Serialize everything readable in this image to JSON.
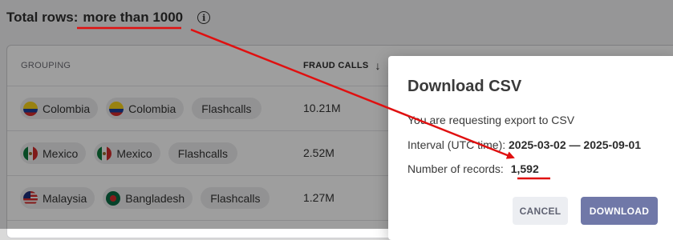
{
  "header": {
    "total_rows_label": "Total rows:",
    "total_rows_value": "more than 1000"
  },
  "table": {
    "columns": {
      "grouping": "GROUPING",
      "fraud_calls": "FRAUD CALLS"
    },
    "rows": [
      {
        "from": "Colombia",
        "to": "Colombia",
        "type": "Flashcalls",
        "fraud_calls": "10.21M"
      },
      {
        "from": "Mexico",
        "to": "Mexico",
        "type": "Flashcalls",
        "fraud_calls": "2.52M"
      },
      {
        "from": "Malaysia",
        "to": "Bangladesh",
        "type": "Flashcalls",
        "fraud_calls": "1.27M"
      }
    ]
  },
  "dialog": {
    "title": "Download CSV",
    "request_text": "You are requesting export to CSV",
    "interval_label": "Interval (UTC time):",
    "interval_value": "2025-03-02 — 2025-09-01",
    "records_label": "Number of records:",
    "records_value": "1,592",
    "cancel_label": "CANCEL",
    "download_label": "DOWNLOAD"
  },
  "icons": {
    "info": "info-icon",
    "sort": "arrow-down-icon"
  },
  "colors": {
    "annotation": "#e01010",
    "download_button": "#7078a8"
  }
}
